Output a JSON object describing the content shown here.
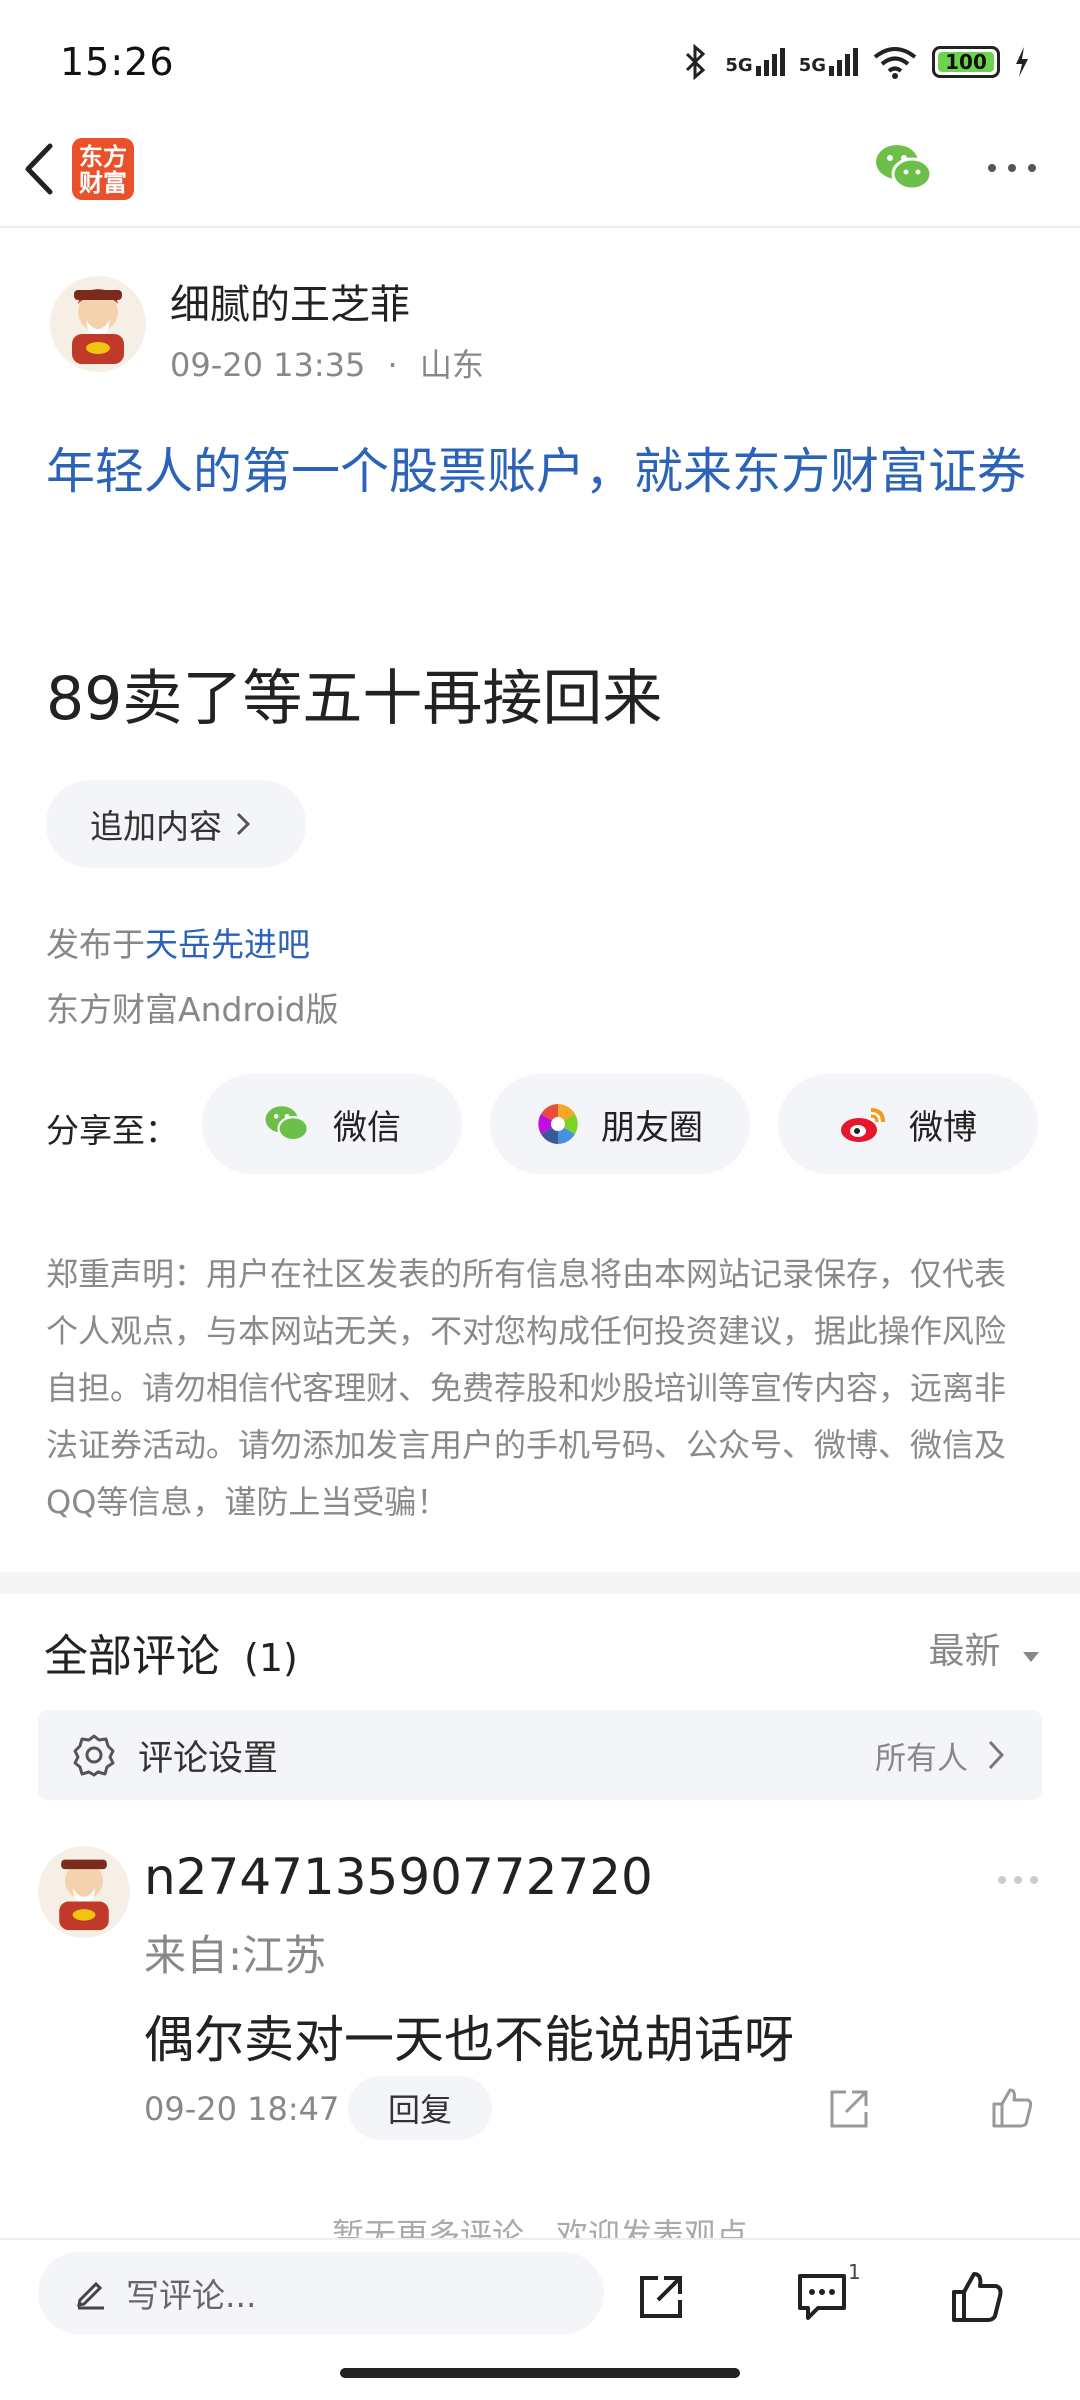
{
  "status_bar": {
    "time": "15:26",
    "net1": "5G",
    "net2": "5G",
    "wifi_num": "7",
    "battery": "100"
  },
  "header": {
    "logo_text_line1": "东方",
    "logo_text_line2": "财富"
  },
  "post": {
    "author": "细腻的王芝菲",
    "date": "09-20 13:35",
    "separator": "·",
    "location": "山东",
    "title": "年轻人的第一个股票账户，就来东方财富证券",
    "content": "89卖了等五十再接回来",
    "add_content_label": "追加内容",
    "published_in_prefix": "发布于",
    "published_in_forum": "天岳先进吧",
    "platform": "东方财富Android版"
  },
  "share": {
    "label": "分享至：",
    "wechat": "微信",
    "moments": "朋友圈",
    "weibo": "微博"
  },
  "disclaimer": "郑重声明：用户在社区发表的所有信息将由本网站记录保存，仅代表个人观点，与本网站无关，不对您构成任何投资建议，据此操作风险自担。请勿相信代客理财、免费荐股和炒股培训等宣传内容，远离非法证券活动。请勿添加发言用户的手机号码、公众号、微博、微信及QQ等信息，谨防上当受骗！",
  "comments": {
    "header": "全部评论",
    "count": "(1)",
    "sort": "最新",
    "settings_label": "评论设置",
    "settings_value": "所有人",
    "items": [
      {
        "user": "n274713590772720",
        "from": "来自:江苏",
        "text": "偶尔卖对一天也不能说胡话呀",
        "time": "09-20 18:47",
        "reply_label": "回复"
      }
    ],
    "no_more": "暂无更多评论，欢迎发表观点"
  },
  "bottom_bar": {
    "write_placeholder": "写评论...",
    "comment_badge": "1"
  },
  "colors": {
    "link_blue": "#2a63b7",
    "brand_orange": "#e8512a",
    "chip_bg": "#f3f5f8"
  }
}
